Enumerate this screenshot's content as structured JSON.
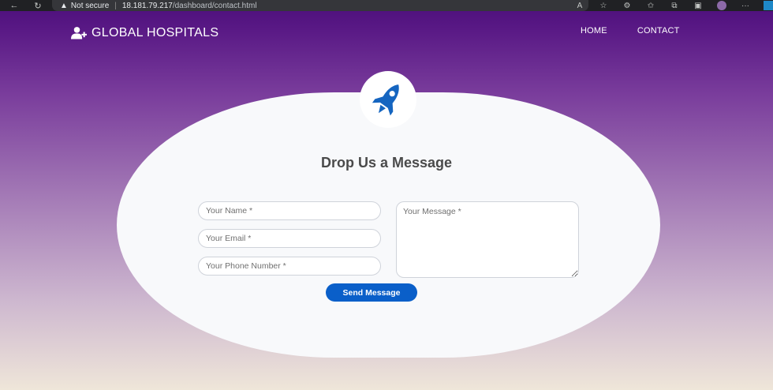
{
  "browser": {
    "security_label": "Not secure",
    "url_host": "18.181.79.217",
    "url_path": "/dashboard/contact.html"
  },
  "site": {
    "brand_name": "GLOBAL HOSPITALS",
    "nav": {
      "home": "HOME",
      "contact": "CONTACT"
    }
  },
  "form": {
    "title": "Drop Us a Message",
    "name_placeholder": "Your Name *",
    "email_placeholder": "Your Email *",
    "phone_placeholder": "Your Phone Number *",
    "message_placeholder": "Your Message *",
    "submit_label": "Send Message"
  },
  "colors": {
    "header_purple": "#4b0d7a",
    "button_blue": "#0a5fc9",
    "rocket_blue": "#1565c0",
    "card_bg": "#f8f9fb"
  },
  "icons": [
    "back-icon",
    "reload-icon",
    "warning-icon",
    "read-aloud-icon",
    "favorite-icon",
    "extensions-icon",
    "favorites-icon",
    "collections-icon",
    "profile-icon",
    "more-icon",
    "user-plus-icon",
    "rocket-icon"
  ]
}
